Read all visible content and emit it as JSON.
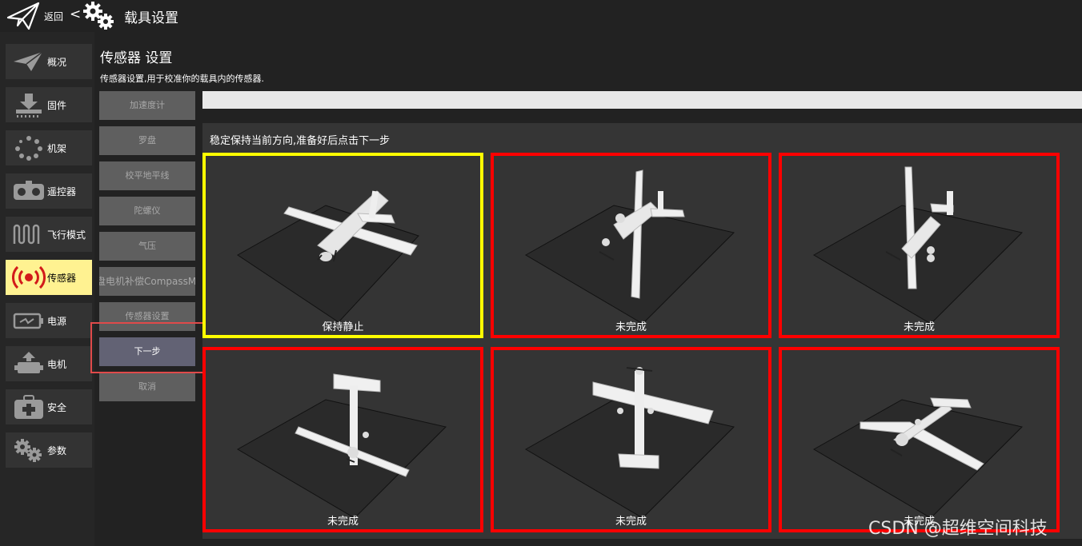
{
  "header": {
    "back_label": "返回",
    "chevron": "<",
    "title": "载具设置",
    "logo_icon": "paper-plane-icon",
    "settings_icon": "gears-icon"
  },
  "sidebar": {
    "items": [
      {
        "label": "概况",
        "icon": "plane-icon",
        "active": false
      },
      {
        "label": "固件",
        "icon": "download-firmware-icon",
        "active": false
      },
      {
        "label": "机架",
        "icon": "airframe-dots-icon",
        "active": false
      },
      {
        "label": "遥控器",
        "icon": "radio-controller-icon",
        "active": false
      },
      {
        "label": "飞行模式",
        "icon": "flight-mode-wave-icon",
        "active": false
      },
      {
        "label": "传感器",
        "icon": "sensor-signal-icon",
        "active": true
      },
      {
        "label": "电源",
        "icon": "battery-icon",
        "active": false
      },
      {
        "label": "电机",
        "icon": "motor-icon",
        "active": false
      },
      {
        "label": "安全",
        "icon": "safety-kit-icon",
        "active": false
      },
      {
        "label": "参数",
        "icon": "gears-icon",
        "active": false
      }
    ],
    "active_color": "#fff291"
  },
  "sensors": {
    "title": "传感器 设置",
    "description": "传感器设置,用于校准你的载具内的传感器.",
    "buttons": [
      {
        "label": "加速度计"
      },
      {
        "label": "罗盘"
      },
      {
        "label": "校平地平线"
      },
      {
        "label": "陀螺仪"
      },
      {
        "label": "气压"
      },
      {
        "label": "盘电机补偿CompassM"
      },
      {
        "label": "传感器设置"
      },
      {
        "label": "下一步"
      },
      {
        "label": "取消"
      }
    ]
  },
  "calibration": {
    "progress": 0,
    "instruction": "稳定保持当前方向,准备好后点击下一步",
    "tiles": [
      {
        "status": "保持静止",
        "state": "current",
        "border_color": "#ffff00"
      },
      {
        "status": "未完成",
        "state": "incomplete",
        "border_color": "#ff0000"
      },
      {
        "status": "未完成",
        "state": "incomplete",
        "border_color": "#ff0000"
      },
      {
        "status": "未完成",
        "state": "incomplete",
        "border_color": "#ff0000"
      },
      {
        "status": "未完成",
        "state": "incomplete",
        "border_color": "#ff0000"
      },
      {
        "status": "未完成",
        "state": "incomplete",
        "border_color": "#ff0000"
      }
    ]
  },
  "watermark": "CSDN @超维空间科技"
}
